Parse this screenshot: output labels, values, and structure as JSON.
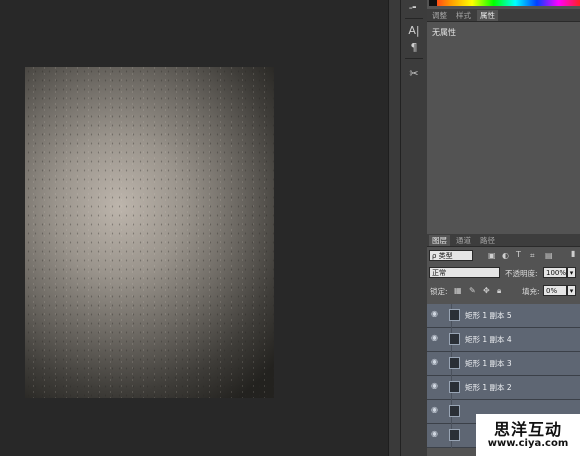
{
  "canvas": {
    "title": ""
  },
  "toolbar": {
    "tools": [
      {
        "name": "pen-tool-icon",
        "glyph": "-╸"
      },
      {
        "name": "character-panel-icon",
        "glyph": "A|"
      },
      {
        "name": "paragraph-panel-icon",
        "glyph": "¶"
      },
      {
        "name": "tool-presets-icon",
        "glyph": "✂"
      }
    ]
  },
  "properties_panel": {
    "tabs": [
      "调整",
      "样式",
      "属性"
    ],
    "active_tab": "属性",
    "empty_text": "无属性"
  },
  "layers_panel": {
    "tabs": [
      "图层",
      "通道",
      "路径"
    ],
    "active_tab": "图层",
    "filter_label": "ρ 类型",
    "blend_mode": "正常",
    "opacity_label": "不透明度:",
    "opacity_value": "100%",
    "lock_label": "锁定:",
    "fill_label": "填充:",
    "fill_value": "0%",
    "layers": [
      {
        "name": "矩形 1 副本 5"
      },
      {
        "name": "矩形 1 副本 4"
      },
      {
        "name": "矩形 1 副本 3"
      },
      {
        "name": "矩形 1 副本 2"
      },
      {
        "name": ""
      },
      {
        "name": ""
      }
    ]
  },
  "watermark": {
    "brand": "思洋互动",
    "url": "www.ciya.com"
  },
  "colors": {
    "layer_selected": "#5e6673",
    "panel_bg": "#535353",
    "workspace_bg": "#282828"
  }
}
